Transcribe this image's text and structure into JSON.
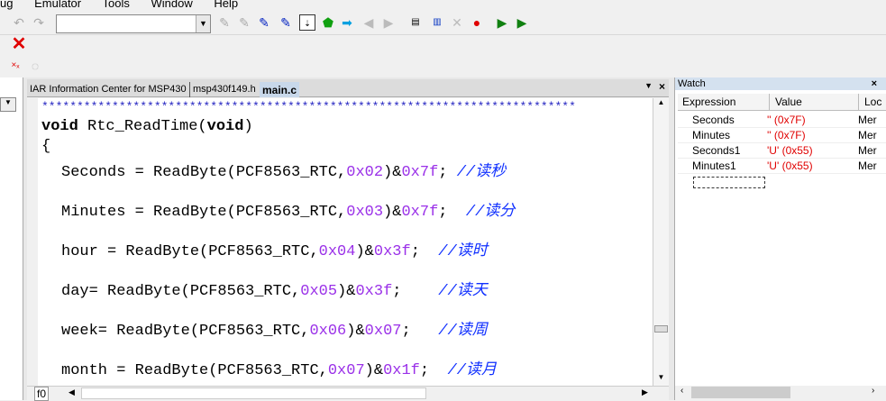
{
  "menu": [
    "ug",
    "Emulator",
    "Tools",
    "Window",
    "Help"
  ],
  "toolbar": {
    "combo_value": "",
    "icons": [
      "undo-icon",
      "redo-icon",
      "toggle-bookmark-icon",
      "next-bookmark-icon",
      "toggle-breakpoint-icon",
      "enable-breakpoint-icon",
      "go-to-icon",
      "step-icon",
      "step-over-icon",
      "back-icon",
      "forward-icon",
      "make-icon",
      "compile-icon",
      "stop-build-icon",
      "debug-icon",
      "download-debug-icon"
    ]
  },
  "tabs": [
    "IAR Information Center for MSP430",
    "msp430f149.h",
    "main.c"
  ],
  "code": {
    "stars": "****************************************************************************",
    "func_kw": "void",
    "func_name": " Rtc_ReadTime(",
    "func_arg": "void",
    "func_close": ")",
    "brace": "{",
    "lines": [
      {
        "pre": "Seconds = ReadByte(PCF8563_RTC,",
        "addr": "0x02",
        ")&": ")&",
        "mask": "0x7f",
        "post": "; ",
        "comment": "//读秒"
      },
      {
        "pre": "Minutes = ReadByte(PCF8563_RTC,",
        "addr": "0x03",
        "mask": "0x7f",
        "post": ";  ",
        "comment": "//读分"
      },
      {
        "pre": "hour = ReadByte(PCF8563_RTC,",
        "addr": "0x04",
        "mask": "0x3f",
        "post": ";  ",
        "comment": "//读时"
      },
      {
        "pre": "day= ReadByte(PCF8563_RTC,",
        "addr": "0x05",
        "mask": "0x3f",
        "post": ";    ",
        "comment": "//读天"
      },
      {
        "pre": "week= ReadByte(PCF8563_RTC,",
        "addr": "0x06",
        "mask": "0x07",
        "post": ";   ",
        "comment": "//读周"
      },
      {
        "pre": "month = ReadByte(PCF8563_RTC,",
        "addr": "0x07",
        "mask": "0x1f",
        "post": ";  ",
        "comment": "//读月"
      }
    ],
    "amp": ")&"
  },
  "bottom_tab": "f0",
  "watch": {
    "title": "Watch",
    "close": "×",
    "columns": [
      "Expression",
      "Value",
      "Loc"
    ],
    "rows": [
      {
        "expr": "Seconds",
        "value": "'' (0x7F)",
        "loc": "Mer"
      },
      {
        "expr": "Minutes",
        "value": "'' (0x7F)",
        "loc": "Mer"
      },
      {
        "expr": "Seconds1",
        "value": "'U' (0x55)",
        "loc": "Mer"
      },
      {
        "expr": "Minutes1",
        "value": "'U' (0x55)",
        "loc": "Mer"
      }
    ],
    "value_color": "#e00000"
  }
}
